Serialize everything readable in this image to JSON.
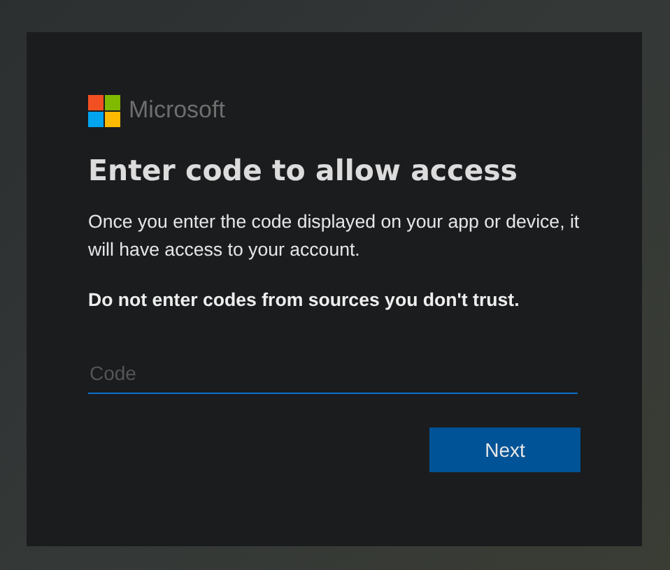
{
  "brand": {
    "name": "Microsoft"
  },
  "title": "Enter code to allow access",
  "description": "Once you enter the code displayed on your app or device, it will have access to your account.",
  "warning": "Do not enter codes from sources you don't trust.",
  "code_field": {
    "placeholder": "Code",
    "focused": true
  },
  "buttons": [
    {
      "label": "Next",
      "kind": "primary"
    }
  ]
}
